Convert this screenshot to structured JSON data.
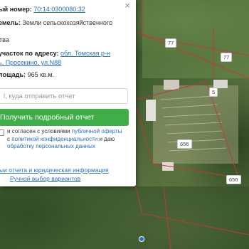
{
  "panel": {
    "cadastral_label": "ый номер:",
    "cadastral_number": "70:14:0300080:32",
    "category_label": "емель:",
    "category_value": "Земли сельскохозяйственного",
    "usage_fragment": "тва",
    "address_label": "участок по адресу:",
    "address_line1": "обл. Томская р-н",
    "address_line2": "ь, Просекино, ул.N88",
    "area_label": "лощадь:",
    "area_value": "965 кв.м.",
    "email_placeholder": "l, куда отправить отчет",
    "report_button": "Получить подробный отчет",
    "agree_text_1": "и согласен с условиями",
    "offer_link": "публичной оферты",
    "agree_text_2": "с",
    "privacy_link": "политикой конфиденциальности",
    "agree_text_3": "и даю",
    "consent_link": "обработку персональных данных",
    "legal_link": "ыи отчета и юридическая информация",
    "manual_link": "Ручной выбор вариантов",
    "close_glyph": "×"
  },
  "map_labels": [
    "77",
    "77",
    "5",
    "656",
    "656"
  ],
  "colors": {
    "accent_green": "#3fae49",
    "link_blue": "#2a6fb8",
    "parcel_red": "#c03a3a"
  }
}
